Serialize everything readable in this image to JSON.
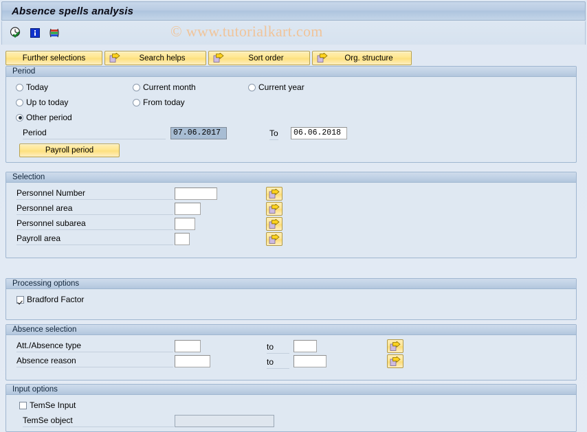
{
  "window": {
    "title": "Absence spells analysis"
  },
  "watermark": {
    "text": "© www.tutorialkart.com"
  },
  "toolbar": {
    "icons": [
      {
        "name": "execute-clock-icon",
        "title": "Execute"
      },
      {
        "name": "info-icon",
        "title": "Information"
      },
      {
        "name": "variant-icon",
        "title": "Get variant"
      }
    ]
  },
  "buttons": [
    {
      "label": "Further selections",
      "icon": null
    },
    {
      "label": "Search helps",
      "icon": "arrow-right-icon"
    },
    {
      "label": "Sort order",
      "icon": "arrow-right-icon"
    },
    {
      "label": "Org. structure",
      "icon": "arrow-right-icon"
    }
  ],
  "period": {
    "header": "Period",
    "radios": [
      {
        "label": "Today",
        "selected": false
      },
      {
        "label": "Current month",
        "selected": false
      },
      {
        "label": "Current year",
        "selected": false
      },
      {
        "label": "Up to today",
        "selected": false
      },
      {
        "label": "From today",
        "selected": false
      },
      {
        "label": "Other period",
        "selected": true
      }
    ],
    "period_label": "Period",
    "period_from_value": "07.06.2017",
    "to_label": "To",
    "period_to_value": "06.06.2018",
    "payroll_period_button": "Payroll period"
  },
  "selection": {
    "header": "Selection",
    "rows": [
      {
        "label": "Personnel Number",
        "value": ""
      },
      {
        "label": "Personnel area",
        "value": ""
      },
      {
        "label": "Personnel subarea",
        "value": ""
      },
      {
        "label": "Payroll area",
        "value": ""
      }
    ]
  },
  "processing_options": {
    "header": "Processing options",
    "bradford_factor": {
      "label": "Bradford Factor",
      "checked": true
    }
  },
  "absence_selection": {
    "header": "Absence selection",
    "to_label": "to",
    "rows": [
      {
        "label": "Att./Absence type",
        "from": "",
        "to": ""
      },
      {
        "label": "Absence reason",
        "from": "",
        "to": ""
      }
    ]
  },
  "input_options": {
    "header": "Input options",
    "temse_input": {
      "label": "TemSe Input",
      "checked": false
    },
    "temse_object": {
      "label": "TemSe object",
      "value": ""
    }
  },
  "colors": {
    "accent_yellow": "#ffe895",
    "panel_blue": "#dfe8f2",
    "header_blue": "#bed0e4",
    "watermark": "#f0c49a"
  }
}
